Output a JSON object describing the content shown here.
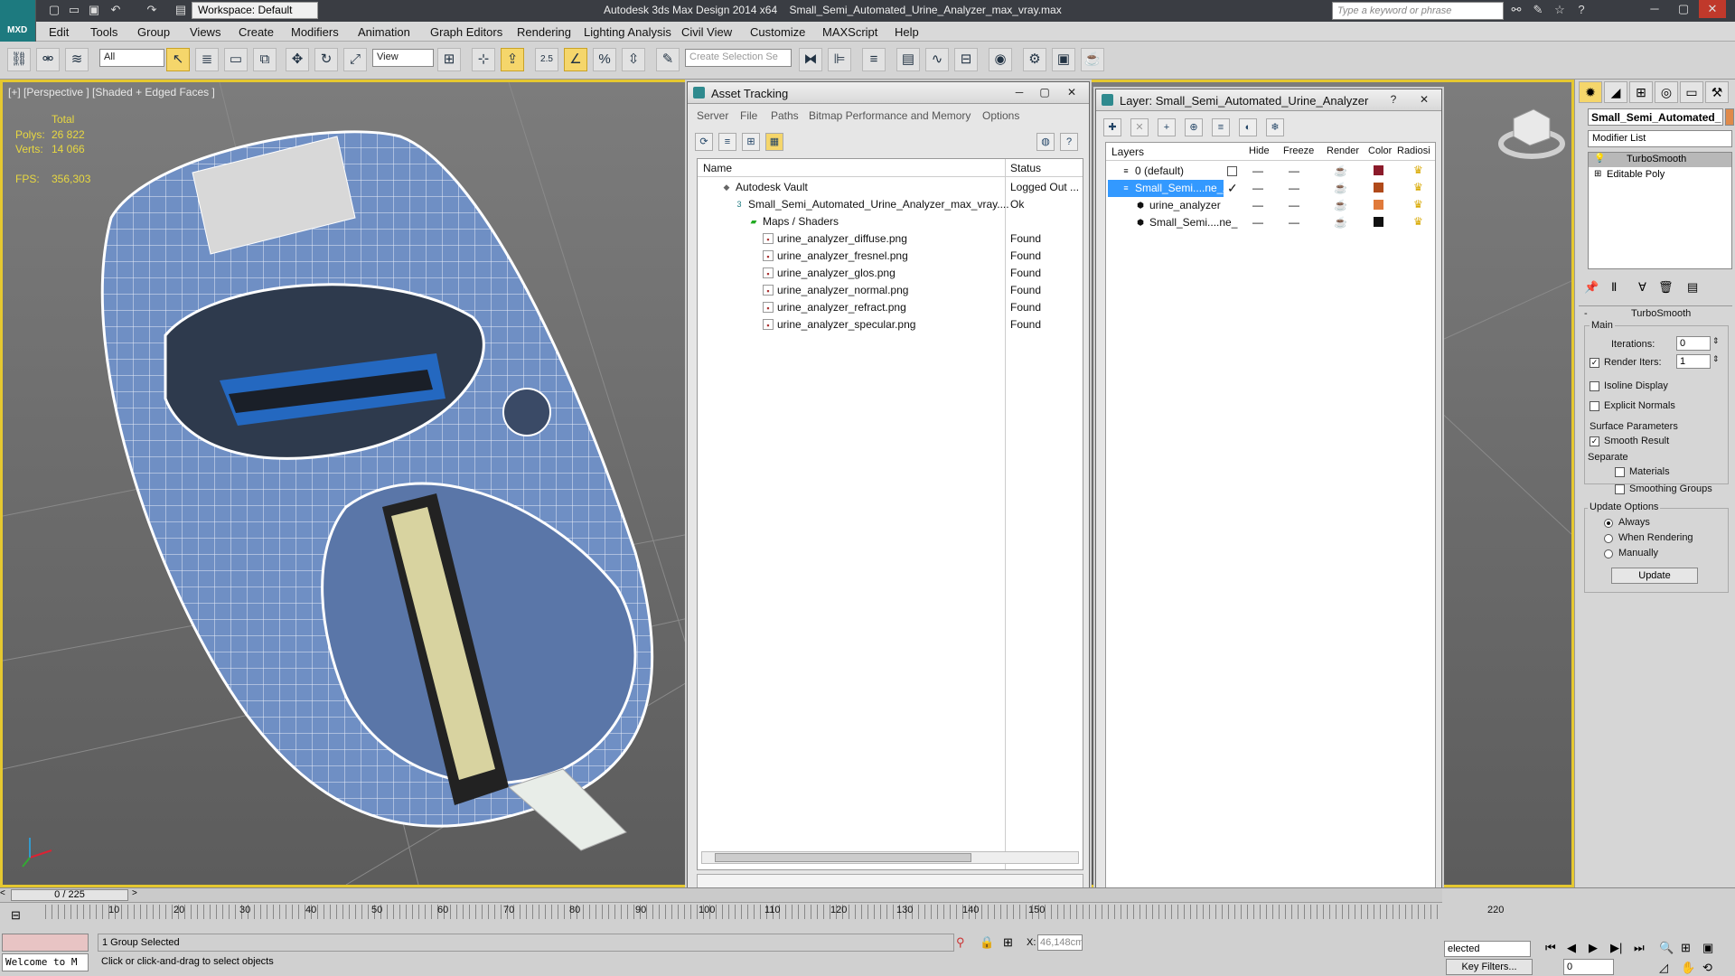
{
  "title_bar": {
    "app_title": "Autodesk 3ds Max Design 2014 x64",
    "file_name": "Small_Semi_Automated_Urine_Analyzer_max_vray.max",
    "workspace_label": "Workspace: Default",
    "search_placeholder": "Type a keyword or phrase",
    "logo_text": "MXD"
  },
  "menubar": [
    "Edit",
    "Tools",
    "Group",
    "Views",
    "Create",
    "Modifiers",
    "Animation",
    "Graph Editors",
    "Rendering",
    "Lighting Analysis",
    "Civil View",
    "Customize",
    "MAXScript",
    "Help"
  ],
  "toolbar": {
    "filter_value": "All",
    "coord_value": "View",
    "selection_set_placeholder": "Create Selection Se",
    "snap_label": "2.5"
  },
  "viewport": {
    "label": "[+] [Perspective ] [Shaded + Edged Faces ]",
    "stats": {
      "total_label": "Total",
      "polys_label": "Polys:",
      "polys_value": "26 822",
      "verts_label": "Verts:",
      "verts_value": "14 066",
      "fps_label": "FPS:",
      "fps_value": "356,303"
    }
  },
  "asset_tracking": {
    "title": "Asset Tracking",
    "menu": [
      "Server",
      "File",
      "Paths",
      "Bitmap Performance and Memory",
      "Options"
    ],
    "columns": [
      "Name",
      "Status"
    ],
    "rows": [
      {
        "name": "Autodesk Vault",
        "status": "Logged Out ..."
      },
      {
        "name": "Small_Semi_Automated_Urine_Analyzer_max_vray....",
        "status": "Ok"
      },
      {
        "name": "Maps / Shaders",
        "status": ""
      },
      {
        "name": "urine_analyzer_diffuse.png",
        "status": "Found"
      },
      {
        "name": "urine_analyzer_fresnel.png",
        "status": "Found"
      },
      {
        "name": "urine_analyzer_glos.png",
        "status": "Found"
      },
      {
        "name": "urine_analyzer_normal.png",
        "status": "Found"
      },
      {
        "name": "urine_analyzer_refract.png",
        "status": "Found"
      },
      {
        "name": "urine_analyzer_specular.png",
        "status": "Found"
      }
    ]
  },
  "layer_window": {
    "title": "Layer: Small_Semi_Automated_Urine_Analyzer",
    "columns": [
      "Layers",
      "Hide",
      "Freeze",
      "Render",
      "Color",
      "Radiosi"
    ],
    "rows": [
      {
        "name": "0 (default)",
        "color": "#8b1a2a"
      },
      {
        "name": "Small_Semi....ne_An",
        "color": "#b04a1a"
      },
      {
        "name": "urine_analyzer",
        "color": "#e07a3a"
      },
      {
        "name": "Small_Semi....ne_",
        "color": "#111111"
      }
    ]
  },
  "command_panel": {
    "object_name": "Small_Semi_Automated_",
    "modifier_list": "Modifier List",
    "stack": [
      "TurboSmooth",
      "Editable Poly"
    ],
    "rollout_title": "TurboSmooth",
    "main_label": "Main",
    "iterations_label": "Iterations:",
    "iterations_value": "0",
    "render_iters_label": "Render Iters:",
    "render_iters_value": "1",
    "isoline_label": "Isoline Display",
    "explicit_normals_label": "Explicit Normals",
    "surface_params_label": "Surface Parameters",
    "smooth_result_label": "Smooth Result",
    "separate_label": "Separate",
    "materials_label": "Materials",
    "smoothing_groups_label": "Smoothing Groups",
    "update_options_label": "Update Options",
    "always_label": "Always",
    "when_rendering_label": "When Rendering",
    "manually_label": "Manually",
    "update_button": "Update"
  },
  "timeline": {
    "frame_counter": "0 / 225",
    "ticks": [
      "10",
      "20",
      "30",
      "40",
      "50",
      "60",
      "70",
      "80",
      "90",
      "100",
      "110",
      "120",
      "130",
      "140",
      "150",
      "220"
    ],
    "status_selected": "1 Group Selected",
    "prompt": "Click or click-and-drag to select objects",
    "maxscript_text": "Welcome to M",
    "x_label": "X:",
    "x_value": "46,148cm",
    "selected_dropdown": "elected",
    "key_filters": "Key Filters...",
    "frame_value": "0"
  }
}
